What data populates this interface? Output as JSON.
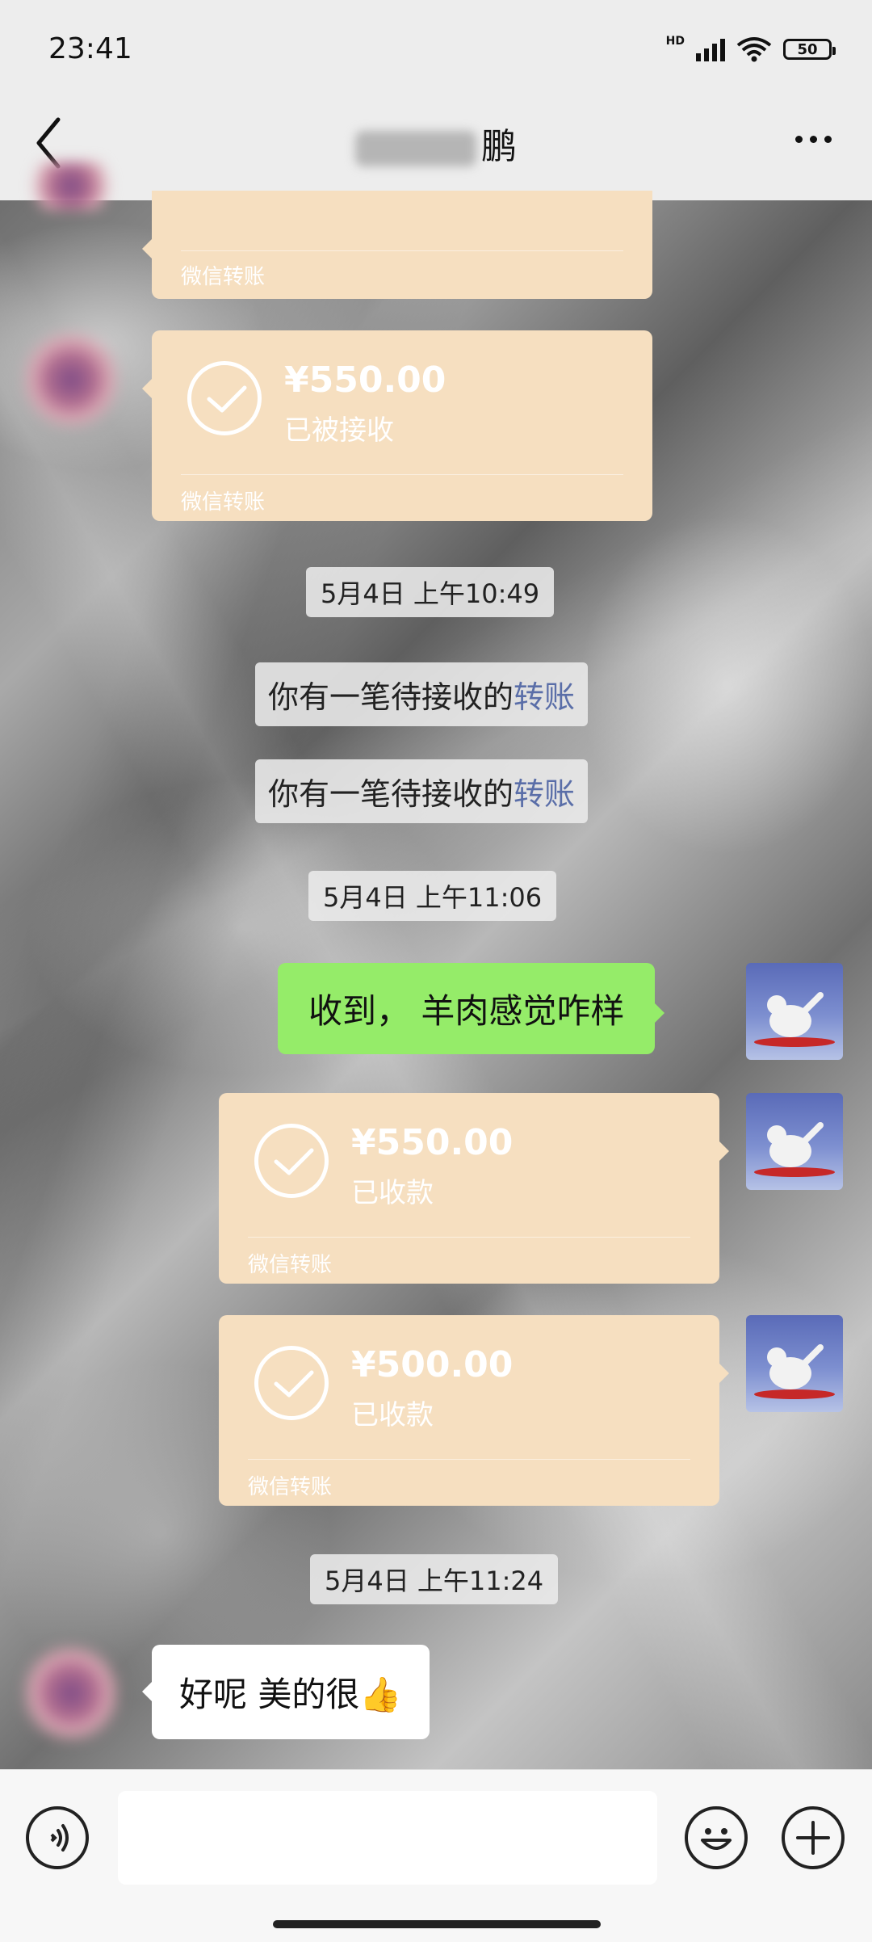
{
  "status_bar": {
    "time": "23:41",
    "network_label": "HD",
    "battery": "50"
  },
  "header": {
    "title_visible_char": "鹏",
    "back_icon": "chevron-left-icon",
    "more_icon": "more-horizontal-icon"
  },
  "messages": {
    "transfer_partial_brand": "微信转账",
    "transfer_received_1": {
      "amount": "¥550.00",
      "status": "已被接收",
      "brand": "微信转账"
    },
    "time_1": "5月4日 上午10:49",
    "system_1": {
      "text": "你有一笔待接收的",
      "link": "转账"
    },
    "system_2": {
      "text": "你有一笔待接收的",
      "link": "转账"
    },
    "time_2": "5月4日 上午11:06",
    "outgoing_text": "收到， 羊肉感觉咋样",
    "transfer_collected_1": {
      "amount": "¥550.00",
      "status": "已收款",
      "brand": "微信转账"
    },
    "transfer_collected_2": {
      "amount": "¥500.00",
      "status": "已收款",
      "brand": "微信转账"
    },
    "time_3": "5月4日 上午11:24",
    "incoming_text": "好呢 美的很👍"
  },
  "input_bar": {
    "placeholder": "",
    "voice_icon": "voice-icon",
    "emoji_icon": "emoji-icon",
    "plus_icon": "plus-icon"
  },
  "colors": {
    "transfer_bg": "#f6dfc0",
    "outgoing_bubble": "#95ec69",
    "link": "#5a6ea8",
    "header_bg": "#ededed"
  }
}
